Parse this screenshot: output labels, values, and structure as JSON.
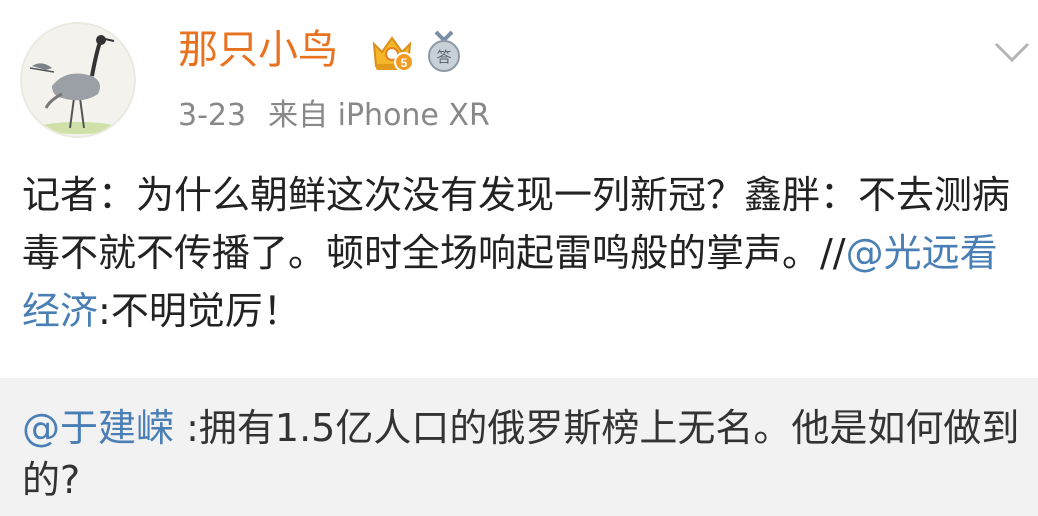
{
  "user": {
    "name": "那只小鸟",
    "vip_level": "5",
    "answer_badge": "答"
  },
  "meta": {
    "date": "3-23",
    "source": "来自 iPhone XR"
  },
  "post": {
    "text": "记者：为什么朝鲜这次没有发现一列新冠？鑫胖：不去测病毒不就不传播了。顿时全场响起雷鸣般的掌声。//",
    "mention": "@光远看经济",
    "mention_text": ":不明觉厉！"
  },
  "repost": {
    "mention": "@于建嵘",
    "text": " :拥有1.5亿人口的俄罗斯榜上无名。他是如何做到的?"
  },
  "colors": {
    "username": "#e8721f",
    "link": "#4a7fb5",
    "meta": "#888888",
    "repost_bg": "#f2f2f2"
  },
  "icons": {
    "vip": "crown-vip-icon",
    "answer": "answer-medal-icon",
    "dropdown": "chevron-down-icon"
  }
}
